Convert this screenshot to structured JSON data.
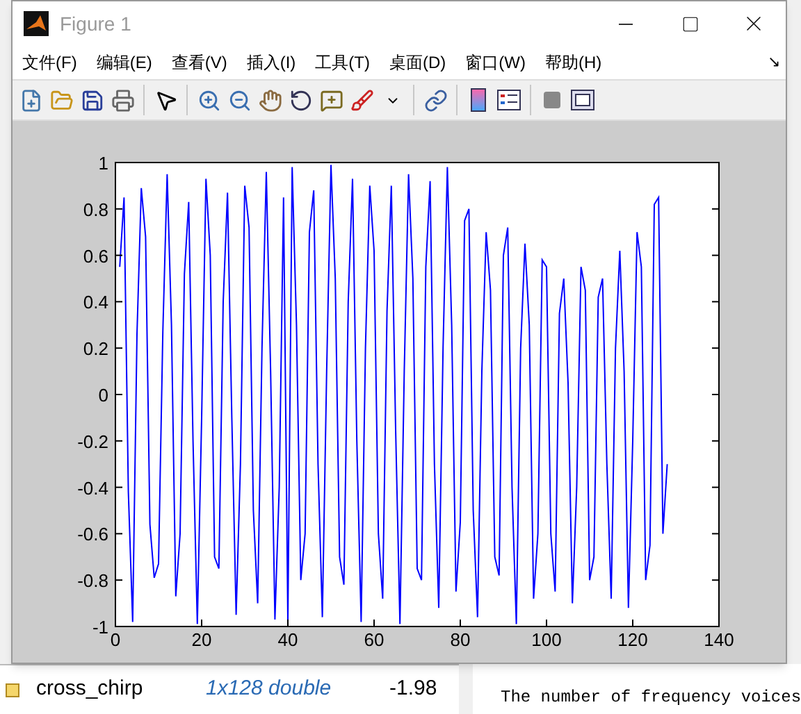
{
  "window": {
    "title": "Figure 1"
  },
  "menu": [
    "文件(F)",
    "编辑(E)",
    "查看(V)",
    "插入(I)",
    "工具(T)",
    "桌面(D)",
    "窗口(W)",
    "帮助(H)"
  ],
  "menu_arrow": "↘",
  "plot": {
    "chart_data": {
      "type": "line",
      "xlim": [
        0,
        140
      ],
      "ylim": [
        -1,
        1
      ],
      "xticks": [
        0,
        20,
        40,
        60,
        80,
        100,
        120,
        140
      ],
      "yticks": [
        {
          "value": -1,
          "label": "-1"
        },
        {
          "value": -0.8,
          "label": "-0.8"
        },
        {
          "value": -0.6,
          "label": "-0.6"
        },
        {
          "value": -0.4,
          "label": "-0.4"
        },
        {
          "value": -0.2,
          "label": "-0.2"
        },
        {
          "value": 0,
          "label": "0"
        },
        {
          "value": 0.2,
          "label": "0.2"
        },
        {
          "value": 0.4,
          "label": "0.4"
        },
        {
          "value": 0.6,
          "label": "0.6"
        },
        {
          "value": 0.8,
          "label": "0.8"
        },
        {
          "value": 1,
          "label": "1"
        }
      ],
      "x": [
        1,
        2,
        3,
        4,
        5,
        6,
        7,
        8,
        9,
        10,
        11,
        12,
        13,
        14,
        15,
        16,
        17,
        18,
        19,
        20,
        21,
        22,
        23,
        24,
        25,
        26,
        27,
        28,
        29,
        30,
        31,
        32,
        33,
        34,
        35,
        36,
        37,
        38,
        39,
        40,
        41,
        42,
        43,
        44,
        45,
        46,
        47,
        48,
        49,
        50,
        51,
        52,
        53,
        54,
        55,
        56,
        57,
        58,
        59,
        60,
        61,
        62,
        63,
        64,
        65,
        66,
        67,
        68,
        69,
        70,
        71,
        72,
        73,
        74,
        75,
        76,
        77,
        78,
        79,
        80,
        81,
        82,
        83,
        84,
        85,
        86,
        87,
        88,
        89,
        90,
        91,
        92,
        93,
        94,
        95,
        96,
        97,
        98,
        99,
        100,
        101,
        102,
        103,
        104,
        105,
        106,
        107,
        108,
        109,
        110,
        111,
        112,
        113,
        114,
        115,
        116,
        117,
        118,
        119,
        120,
        121,
        122,
        123,
        124,
        125,
        126,
        127,
        128
      ],
      "series": [
        {
          "color": "#0000ff",
          "values": [
            0.55,
            0.85,
            -0.42,
            -0.98,
            0.26,
            0.89,
            0.68,
            -0.56,
            -0.79,
            -0.73,
            0.27,
            0.95,
            0.3,
            -0.87,
            -0.6,
            0.52,
            0.83,
            -0.2,
            -0.99,
            -0.1,
            0.93,
            0.6,
            -0.7,
            -0.75,
            0.4,
            0.87,
            -0.1,
            -0.95,
            -0.3,
            0.9,
            0.72,
            -0.5,
            -0.9,
            0.2,
            0.96,
            0.1,
            -0.97,
            -0.4,
            0.85,
            -0.98,
            0.98,
            0.3,
            -0.8,
            -0.6,
            0.7,
            0.88,
            -0.3,
            -0.96,
            0.1,
            0.99,
            0.5,
            -0.7,
            -0.82,
            0.4,
            0.93,
            -0.2,
            -0.98,
            0.2,
            0.9,
            0.62,
            -0.6,
            -0.88,
            0.36,
            0.9,
            -0.15,
            -0.99,
            0.1,
            0.95,
            0.5,
            -0.75,
            -0.8,
            0.55,
            0.92,
            -0.3,
            -0.92,
            0.2,
            0.98,
            0.3,
            -0.85,
            -0.55,
            0.75,
            0.8,
            -0.5,
            -0.96,
            0.1,
            0.7,
            0.45,
            -0.7,
            -0.78,
            0.6,
            0.72,
            -0.4,
            -0.99,
            0.2,
            0.65,
            0.3,
            -0.88,
            -0.6,
            0.58,
            0.55,
            -0.6,
            -0.85,
            0.35,
            0.5,
            0.05,
            -0.9,
            -0.4,
            0.55,
            0.45,
            -0.8,
            -0.7,
            0.42,
            0.5,
            -0.3,
            -0.88,
            0.2,
            0.62,
            0.1,
            -0.92,
            -0.2,
            0.7,
            0.55,
            -0.8,
            -0.65,
            0.82,
            0.85,
            -0.6,
            -0.3
          ]
        }
      ]
    }
  },
  "workspace": {
    "rows": [
      {
        "name": "cross_chirp",
        "value": "1x128 double",
        "min": "-1.98"
      }
    ]
  },
  "command_window": {
    "lines": [
      "The number of frequency voices"
    ]
  }
}
